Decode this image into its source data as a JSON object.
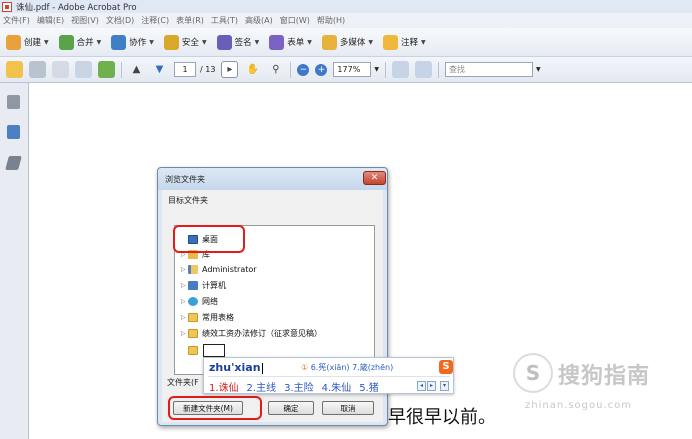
{
  "window": {
    "title": "诛仙.pdf - Adobe Acrobat Pro"
  },
  "menu": [
    "文件(F)",
    "编辑(E)",
    "视图(V)",
    "文档(D)",
    "注释(C)",
    "表单(R)",
    "工具(T)",
    "高级(A)",
    "窗口(W)",
    "帮助(H)"
  ],
  "tasks": [
    {
      "label": "创建",
      "color": "#e9a23b"
    },
    {
      "label": "合并",
      "color": "#5aa34a"
    },
    {
      "label": "协作",
      "color": "#3f7fc6"
    },
    {
      "label": "安全",
      "color": "#d9a82a"
    },
    {
      "label": "签名",
      "color": "#6a5fb8"
    },
    {
      "label": "表单",
      "color": "#7b63c4"
    },
    {
      "label": "多媒体",
      "color": "#e7b33d"
    },
    {
      "label": "注释",
      "color": "#f0b83a"
    }
  ],
  "nav": {
    "page_current": "1",
    "page_total": "/ 13",
    "zoom": "177%",
    "find_placeholder": "查找"
  },
  "dialog": {
    "title": "浏览文件夹",
    "close_glyph": "✕",
    "target_label": "目标文件夹",
    "tree": [
      {
        "label": "桌面",
        "icon": "desktop-icon",
        "arrow": ""
      },
      {
        "label": "库",
        "icon": "library-icon",
        "arrow": "▷"
      },
      {
        "label": "Administrator",
        "icon": "user-folder-icon",
        "arrow": "▷"
      },
      {
        "label": "计算机",
        "icon": "computer-icon",
        "arrow": "▷"
      },
      {
        "label": "网络",
        "icon": "network-icon",
        "arrow": "▷"
      },
      {
        "label": "常用表格",
        "icon": "folder-icon",
        "arrow": "▷"
      },
      {
        "label": "绩效工资办法修订（征求意见稿）",
        "icon": "folder-icon",
        "arrow": "▷"
      }
    ],
    "folder_label": "文件夹(F",
    "new_folder_button": "新建文件夹(M)",
    "ok_button": "确定",
    "cancel_button": "取消"
  },
  "ime": {
    "pinyin": "zhu'xian",
    "tip_index": "①",
    "tip": "6.筅(xiān) 7.箴(zhēn)",
    "candidates": [
      "1.诛仙",
      "2.主线",
      "3.主险",
      "4.朱仙",
      "5.猪"
    ],
    "logo": "S"
  },
  "document": {
    "text_fragment": "艮早很早以前。"
  },
  "watermark": {
    "logo_glyph": "S",
    "text": "搜狗指南",
    "url": "zhinan.sogou.com"
  }
}
